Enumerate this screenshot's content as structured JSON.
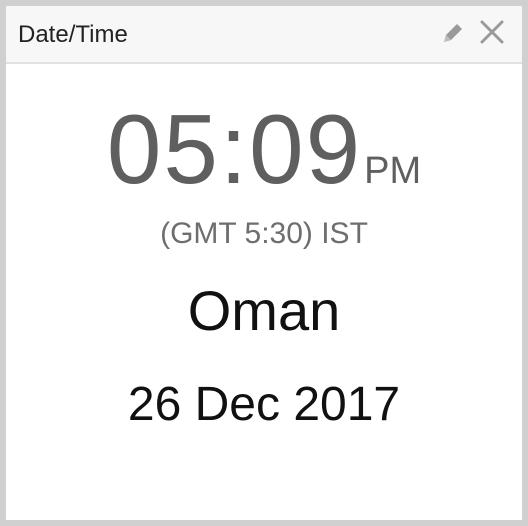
{
  "widget": {
    "title": "Date/Time",
    "actions": {
      "edit_icon": "pencil-icon",
      "close_icon": "close-icon"
    }
  },
  "clock": {
    "time": "05:09",
    "period": "PM",
    "timezone": "(GMT 5:30) IST",
    "location": "Oman",
    "date": "26 Dec 2017"
  },
  "colors": {
    "border": "#d0d0d0",
    "header_bg": "#f7f7f7",
    "time_text": "#5f5f5f",
    "icon": "#9a9a9a"
  }
}
